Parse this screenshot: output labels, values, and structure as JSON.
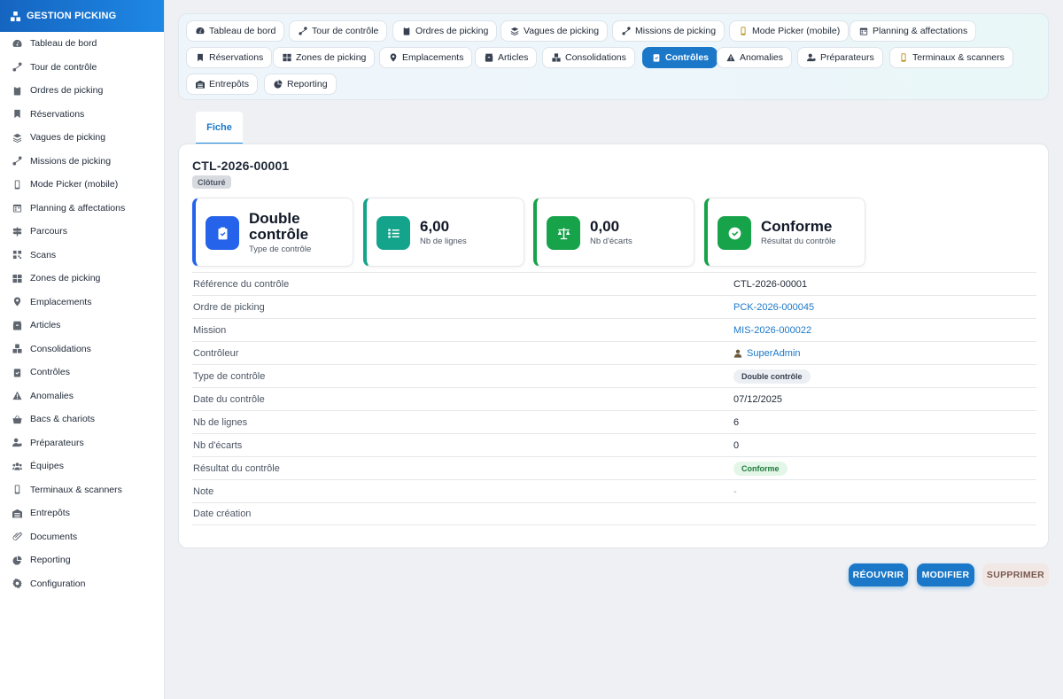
{
  "app": {
    "title": "GESTION PICKING"
  },
  "sidebar": {
    "items": [
      {
        "label": "Tableau de bord",
        "icon": "dashboard-icon"
      },
      {
        "label": "Tour de contrôle",
        "icon": "route-icon"
      },
      {
        "label": "Ordres de picking",
        "icon": "clipboard-icon"
      },
      {
        "label": "Réservations",
        "icon": "bookmark-icon"
      },
      {
        "label": "Vagues de picking",
        "icon": "layers-icon"
      },
      {
        "label": "Missions de picking",
        "icon": "route-icon"
      },
      {
        "label": "Mode Picker (mobile)",
        "icon": "mobile-icon"
      },
      {
        "label": "Planning & affectations",
        "icon": "calendar-icon"
      },
      {
        "label": "Parcours",
        "icon": "signpost-icon"
      },
      {
        "label": "Scans",
        "icon": "barcode-icon"
      },
      {
        "label": "Zones de picking",
        "icon": "grid-icon"
      },
      {
        "label": "Emplacements",
        "icon": "pin-icon"
      },
      {
        "label": "Articles",
        "icon": "box-icon"
      },
      {
        "label": "Consolidations",
        "icon": "boxes-icon"
      },
      {
        "label": "Contrôles",
        "icon": "clipboard-check-icon"
      },
      {
        "label": "Anomalies",
        "icon": "warning-icon"
      },
      {
        "label": "Bacs & chariots",
        "icon": "basket-icon"
      },
      {
        "label": "Préparateurs",
        "icon": "user-gear-icon"
      },
      {
        "label": "Équipes",
        "icon": "users-icon"
      },
      {
        "label": "Terminaux & scanners",
        "icon": "mobile-icon"
      },
      {
        "label": "Entrepôts",
        "icon": "warehouse-icon"
      },
      {
        "label": "Documents",
        "icon": "paperclip-icon"
      },
      {
        "label": "Reporting",
        "icon": "pie-chart-icon"
      },
      {
        "label": "Configuration",
        "icon": "gear-icon"
      }
    ]
  },
  "nav": {
    "chips": [
      {
        "label": "Tableau de bord"
      },
      {
        "label": "Tour de contrôle"
      },
      {
        "label": "Ordres de picking"
      },
      {
        "label": "Vagues de picking"
      },
      {
        "label": "Missions de picking"
      },
      {
        "label": "Mode Picker (mobile)"
      },
      {
        "label": "Planning & affectations"
      },
      {
        "label": "Réservations"
      },
      {
        "label": "Zones de picking"
      },
      {
        "label": "Emplacements"
      },
      {
        "label": "Articles"
      },
      {
        "label": "Consolidations"
      },
      {
        "label": "Contrôles"
      },
      {
        "label": "Anomalies"
      },
      {
        "label": "Préparateurs"
      },
      {
        "label": "Terminaux & scanners"
      },
      {
        "label": "Entrepôts"
      },
      {
        "label": "Reporting"
      }
    ],
    "active": "Contrôles"
  },
  "tabs": {
    "fiche": "Fiche"
  },
  "record": {
    "title": "CTL-2026-00001",
    "status": "Clôturé",
    "kpis": [
      {
        "value": "Double contrôle",
        "label": "Type de contrôle",
        "color": "#2563eb",
        "icon": "clipboard-check-icon"
      },
      {
        "value": "6,00",
        "label": "Nb de lignes",
        "color": "#14a38b",
        "icon": "list-icon"
      },
      {
        "value": "0,00",
        "label": "Nb d'écarts",
        "color": "#16a34a",
        "icon": "scale-icon"
      },
      {
        "value": "Conforme",
        "label": "Résultat du contrôle",
        "color": "#16a34a",
        "icon": "check-circle-icon"
      }
    ],
    "fields": [
      {
        "label": "Référence du contrôle",
        "value": "CTL-2026-00001"
      },
      {
        "label": "Ordre de picking",
        "value": "PCK-2026-000045"
      },
      {
        "label": "Mission",
        "value": "MIS-2026-000022"
      },
      {
        "label": "Contrôleur",
        "value": "SuperAdmin"
      },
      {
        "label": "Type de contrôle",
        "value": "Double contrôle"
      },
      {
        "label": "Date du contrôle",
        "value": "07/12/2025"
      },
      {
        "label": "Nb de lignes",
        "value": "6"
      },
      {
        "label": "Nb d'écarts",
        "value": "0"
      },
      {
        "label": "Résultat du contrôle",
        "value": "Conforme"
      },
      {
        "label": "Note",
        "value": "-"
      },
      {
        "label": "Date création",
        "value": ""
      }
    ]
  },
  "actions": {
    "reopen": "RÉOUVRIR",
    "edit": "MODIFIER",
    "delete": "SUPPRIMER"
  }
}
